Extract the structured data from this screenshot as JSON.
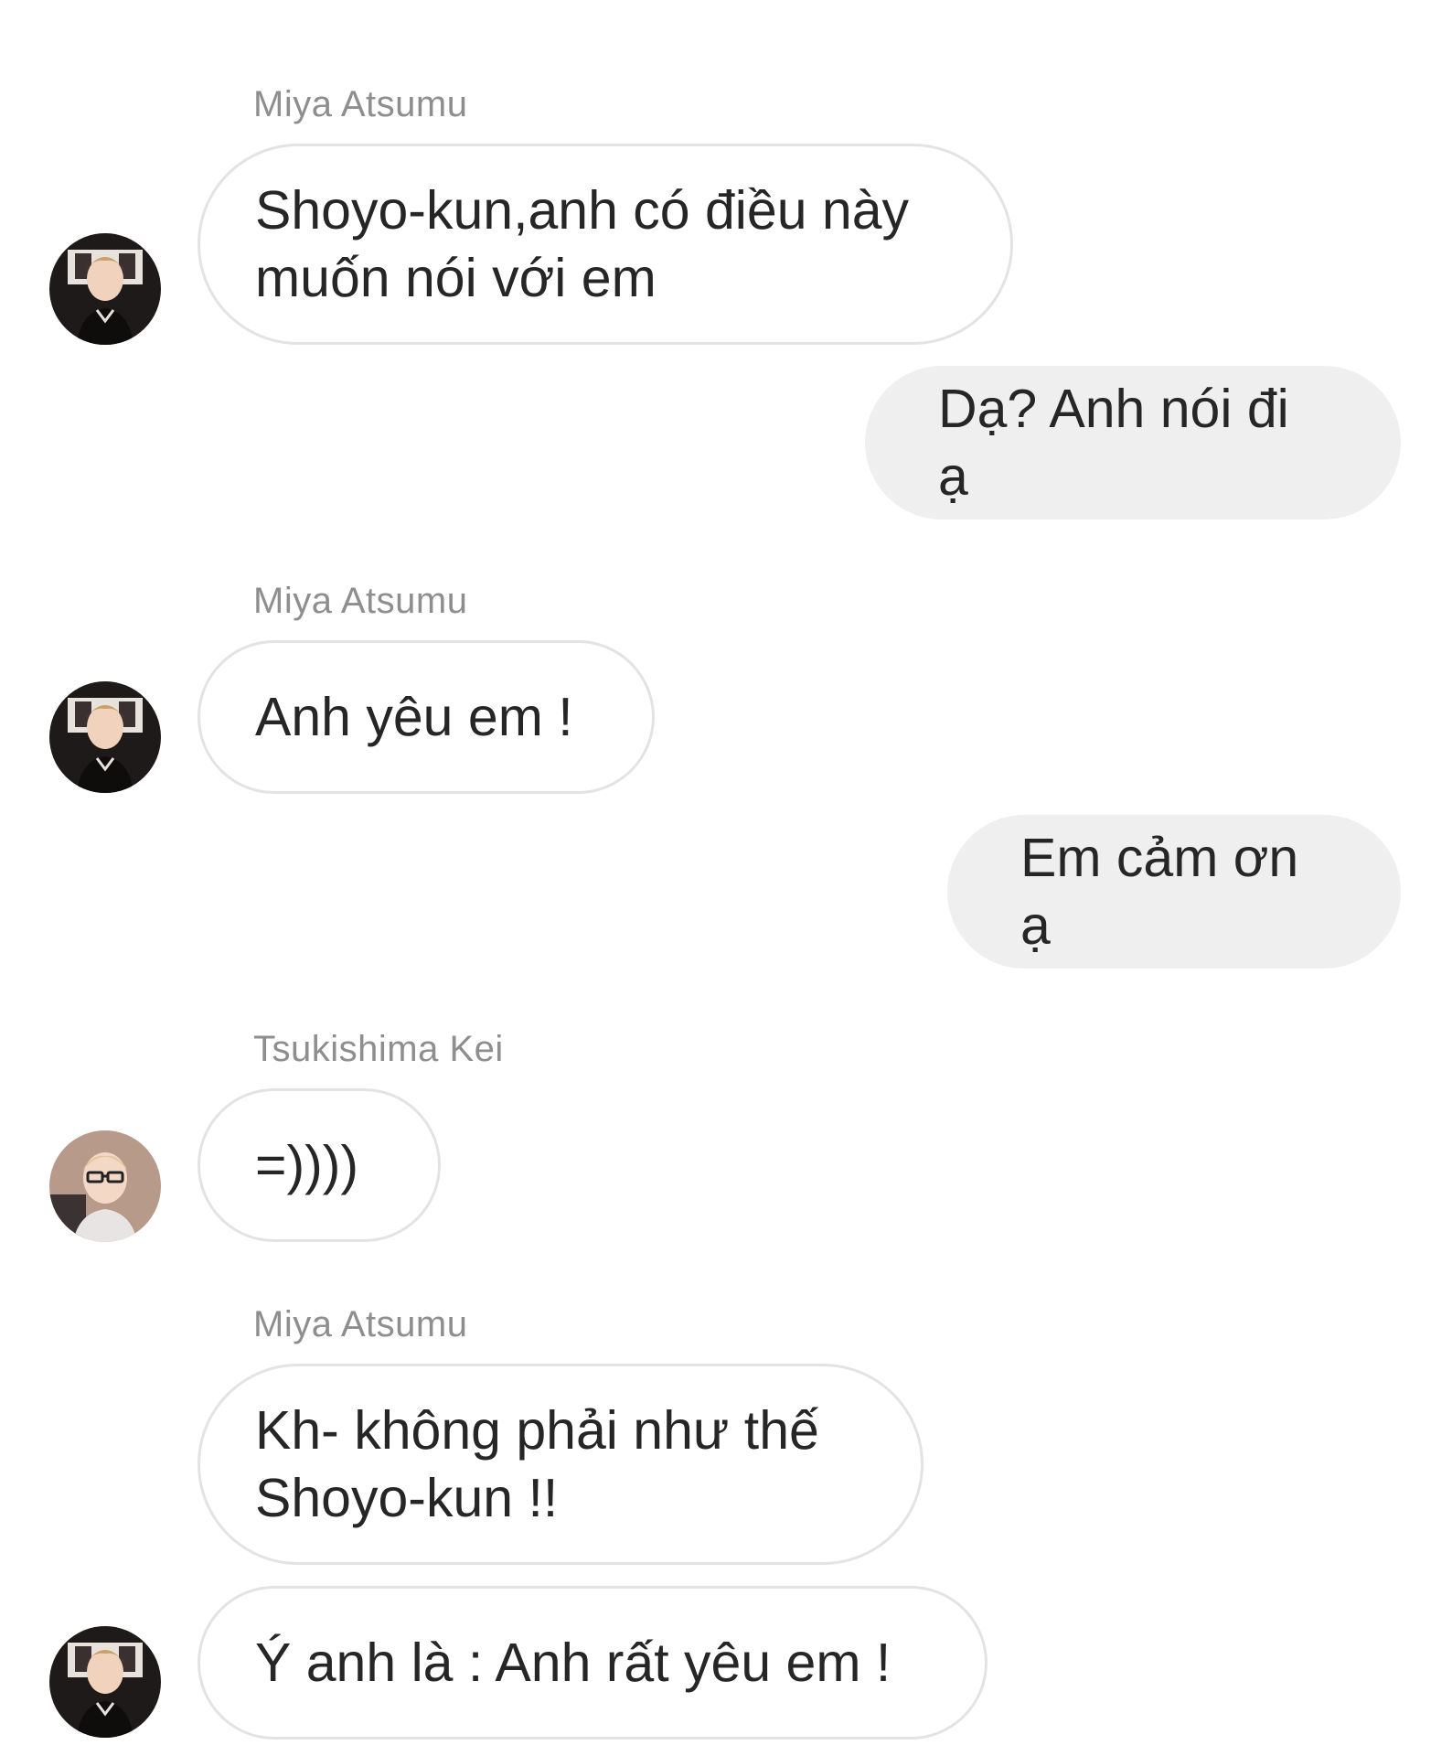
{
  "messages": [
    {
      "sender": "Miya Atsumu",
      "lines": [
        "Shoyo-kun,anh có điều này",
        "muốn nói với em"
      ]
    },
    {
      "text": "Dạ? Anh nói đi ạ"
    },
    {
      "sender": "Miya Atsumu",
      "lines": [
        "Anh yêu em !"
      ]
    },
    {
      "text": "Em cảm ơn ạ"
    },
    {
      "sender": "Tsukishima Kei",
      "lines": [
        "=))))"
      ]
    },
    {
      "sender": "Miya Atsumu",
      "lines": [
        "Kh- không phải như thế",
        "Shoyo-kun !!"
      ]
    },
    {
      "lines": [
        "Ý anh là : Anh rất yêu em !"
      ]
    }
  ],
  "avatars": {
    "atsumu": "avatar-atsumu",
    "tsukishima": "avatar-tsukishima"
  },
  "colors": {
    "incoming_bubble_border": "#e3e3e3",
    "outgoing_bubble_bg": "#efefef",
    "sender_name": "#8e8e8e",
    "text": "#262626"
  }
}
